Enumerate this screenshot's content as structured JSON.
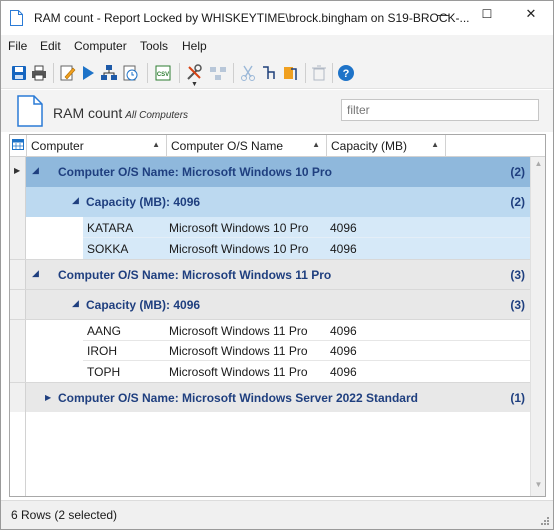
{
  "window": {
    "title": "RAM count - Report Locked by WHISKEYTIME\\brock.bingham on S19-BROCK-...",
    "minimize": "—",
    "maximize": "☐",
    "close": "✕"
  },
  "menu": [
    "File",
    "Edit",
    "Computer",
    "Tools",
    "Help"
  ],
  "toolbar": {
    "icons": [
      "save-icon",
      "print-icon",
      "edit-icon",
      "run-icon",
      "network-icon",
      "schedule-icon",
      "csv-export-icon",
      "tools-icon",
      "group-icon",
      "cut-icon",
      "copy-icon",
      "paste-icon",
      "delete-icon",
      "help-icon"
    ],
    "csv_label": "CSV",
    "help_glyph": "?"
  },
  "report": {
    "title": "RAM count",
    "subtitle": "All Computers",
    "filter_placeholder": "filter"
  },
  "grid": {
    "columns": [
      "Computer",
      "Computer O/S Name",
      "Capacity (MB)"
    ],
    "groups": [
      {
        "label": "Computer O/S Name: Microsoft Windows 10 Pro",
        "count": "(2)",
        "expanded": true,
        "subgroup": {
          "label": "Capacity (MB): 4096",
          "count": "(2)"
        },
        "rows": [
          {
            "computer": "KATARA",
            "os": "Microsoft Windows 10 Pro",
            "capacity": "4096"
          },
          {
            "computer": "SOKKA",
            "os": "Microsoft Windows 10 Pro",
            "capacity": "4096"
          }
        ]
      },
      {
        "label": "Computer O/S Name: Microsoft Windows 11 Pro",
        "count": "(3)",
        "expanded": true,
        "subgroup": {
          "label": "Capacity (MB): 4096",
          "count": "(3)"
        },
        "rows": [
          {
            "computer": "AANG",
            "os": "Microsoft Windows 11 Pro",
            "capacity": "4096"
          },
          {
            "computer": "IROH",
            "os": "Microsoft Windows 11 Pro",
            "capacity": "4096"
          },
          {
            "computer": "TOPH",
            "os": "Microsoft Windows 11 Pro",
            "capacity": "4096"
          }
        ]
      },
      {
        "label": "Computer O/S Name: Microsoft Windows Server 2022 Standard",
        "count": "(1)",
        "expanded": false
      }
    ]
  },
  "status": {
    "text": "6 Rows (2 selected)"
  },
  "colors": {
    "selected_group": "#8fb8dc",
    "selected_subgroup": "#bcd9f0",
    "selected_row": "#d6e9f8",
    "group_bg": "#e8e8e8",
    "group_text": "#1f3f7f"
  }
}
